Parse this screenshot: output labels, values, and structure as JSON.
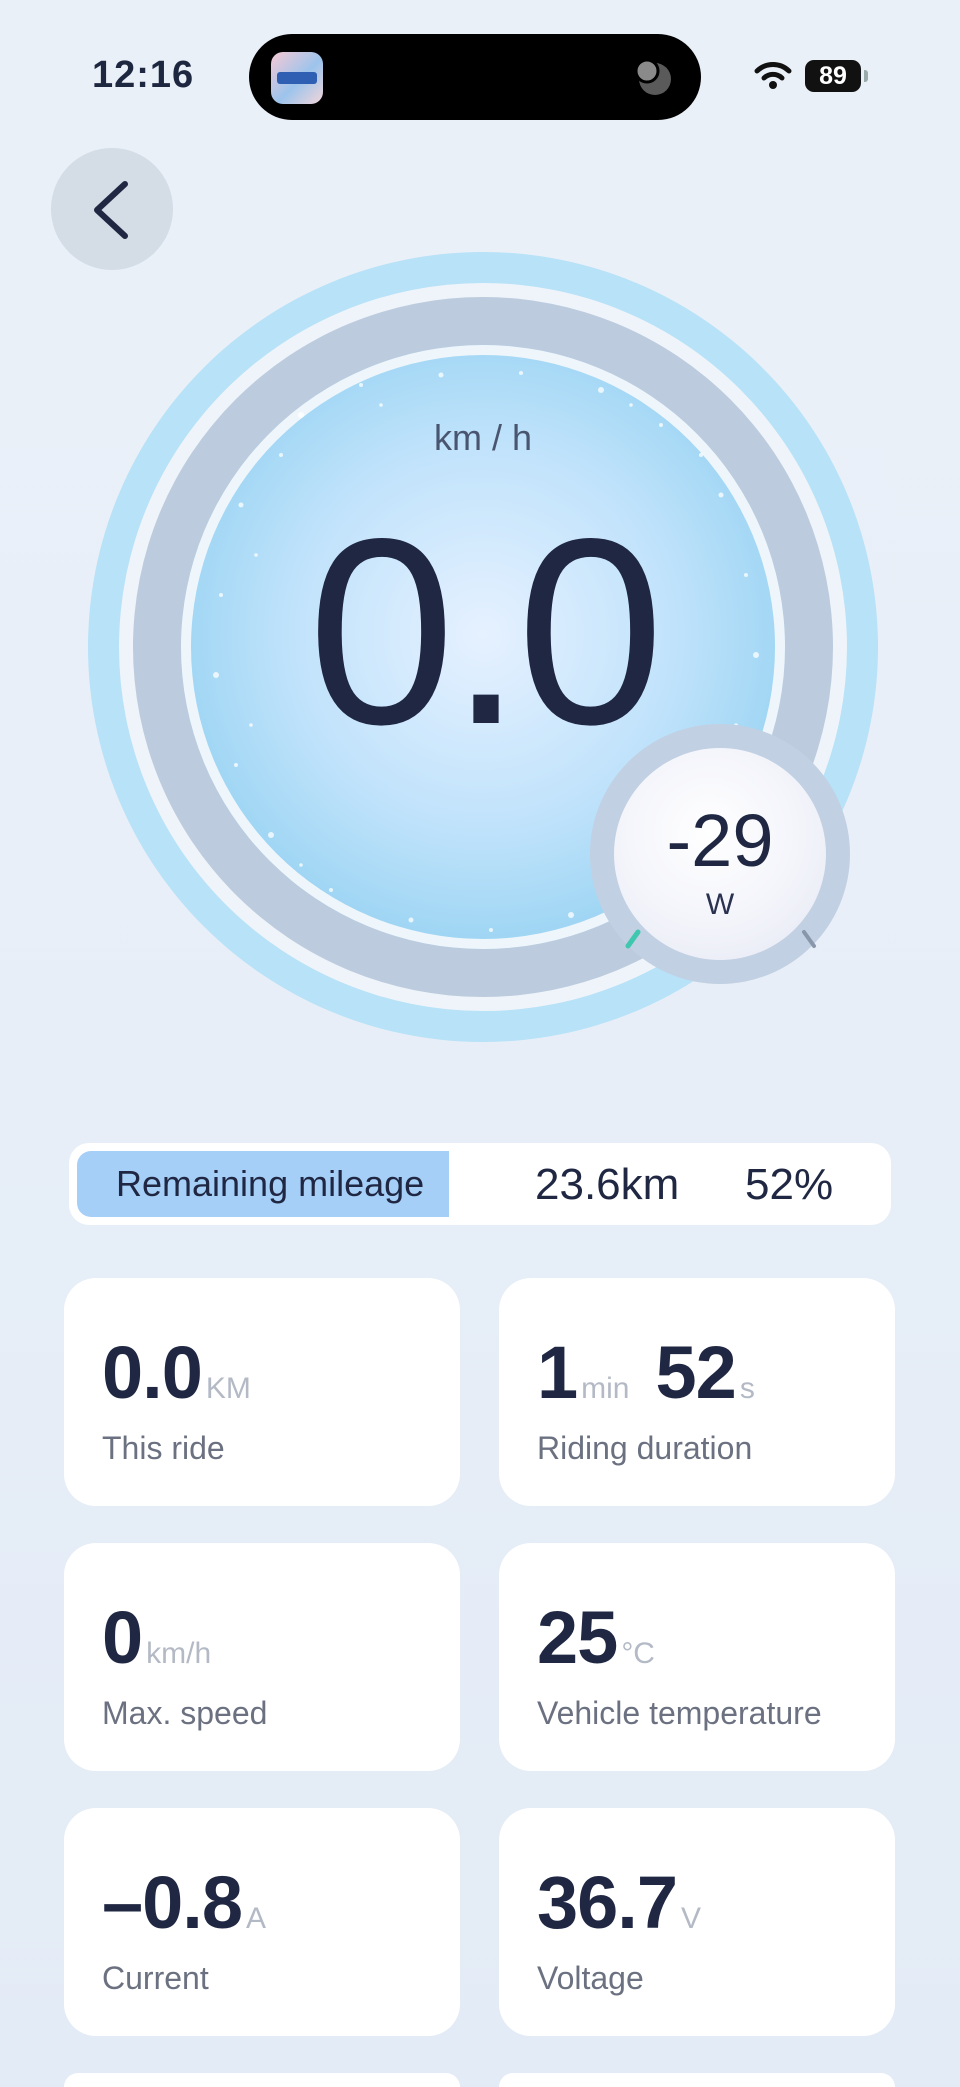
{
  "status_bar": {
    "time": "12:16",
    "battery": "89"
  },
  "gauge": {
    "unit": "km / h",
    "speed": "0.0",
    "power_value": "-29",
    "power_unit": "W"
  },
  "mileage": {
    "label": "Remaining mileage",
    "distance": "23.6km",
    "percent_text": "52%",
    "percent": 52
  },
  "cards": {
    "this_ride": {
      "value": "0.0",
      "unit": "KM",
      "label": "This ride"
    },
    "duration": {
      "min_value": "1",
      "min_unit": "min",
      "sec_value": "52",
      "sec_unit": "s",
      "label": "Riding duration"
    },
    "max_speed": {
      "value": "0",
      "unit": "km/h",
      "label": "Max. speed"
    },
    "temperature": {
      "value": "25",
      "unit": "°C",
      "label": "Vehicle temperature"
    },
    "current": {
      "value": "–0.8",
      "unit": "A",
      "label": "Current"
    },
    "voltage": {
      "value": "36.7",
      "unit": "V",
      "label": "Voltage"
    }
  },
  "colors": {
    "accent_ring": "#b7e2f7",
    "mileage_fill": "#a6cff7",
    "text_dark": "#1f2742"
  }
}
